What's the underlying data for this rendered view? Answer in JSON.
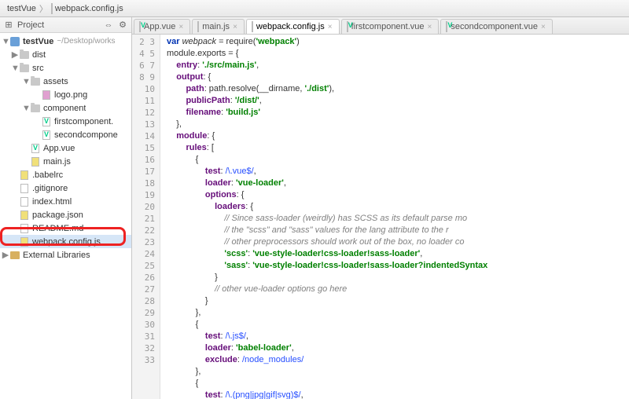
{
  "breadcrumb": {
    "root": "testVue",
    "file": "webpack.config.js"
  },
  "sidebar": {
    "title": "Project",
    "root_name": "testVue",
    "root_path": "~/Desktop/works",
    "nodes": {
      "dist": "dist",
      "src": "src",
      "assets": "assets",
      "logo": "logo.png",
      "component": "component",
      "firstcomp": "firstcomponent.",
      "secondcomp": "secondcompone",
      "appvue": "App.vue",
      "mainjs": "main.js",
      "babelrc": ".babelrc",
      "gitignore": ".gitignore",
      "indexhtml": "index.html",
      "packagejson": "package.json",
      "readme": "README.md",
      "webpack": "webpack.config.js",
      "extlib": "External Libraries"
    }
  },
  "tabs": [
    {
      "label": "App.vue",
      "active": false,
      "kind": "vue"
    },
    {
      "label": "main.js",
      "active": false,
      "kind": "js"
    },
    {
      "label": "webpack.config.js",
      "active": true,
      "kind": "js"
    },
    {
      "label": "firstcomponent.vue",
      "active": false,
      "kind": "vue"
    },
    {
      "label": "secondcomponent.vue",
      "active": false,
      "kind": "vue"
    }
  ],
  "gutter": {
    "start": 2,
    "end": 33
  },
  "code_lines": [
    [
      [
        "kw",
        "var"
      ],
      [
        "",
        " "
      ],
      [
        "id",
        "webpack"
      ],
      [
        "",
        " = require("
      ],
      [
        "str",
        "'webpack'"
      ],
      [
        "",
        ")"
      ]
    ],
    [
      [
        "",
        ""
      ]
    ],
    [
      [
        "",
        "module.exports = {"
      ]
    ],
    [
      [
        "",
        "    "
      ],
      [
        "fld",
        "entry"
      ],
      [
        "",
        ": "
      ],
      [
        "str",
        "'./src/main.js'"
      ],
      [
        "",
        ","
      ]
    ],
    [
      [
        "",
        "    "
      ],
      [
        "fld",
        "output"
      ],
      [
        "",
        ": {"
      ]
    ],
    [
      [
        "",
        "        "
      ],
      [
        "fld",
        "path"
      ],
      [
        "",
        ": path.resolve(__dirname, "
      ],
      [
        "str",
        "'./dist'"
      ],
      [
        "",
        "),"
      ]
    ],
    [
      [
        "",
        "        "
      ],
      [
        "fld",
        "publicPath"
      ],
      [
        "",
        ": "
      ],
      [
        "str",
        "'/dist/'"
      ],
      [
        "",
        ","
      ]
    ],
    [
      [
        "",
        "        "
      ],
      [
        "fld",
        "filename"
      ],
      [
        "",
        ": "
      ],
      [
        "str",
        "'build.js'"
      ]
    ],
    [
      [
        "",
        "    },"
      ]
    ],
    [
      [
        "",
        "    "
      ],
      [
        "fld",
        "module"
      ],
      [
        "",
        ": {"
      ]
    ],
    [
      [
        "",
        "        "
      ],
      [
        "fld",
        "rules"
      ],
      [
        "",
        ": ["
      ]
    ],
    [
      [
        "",
        "            {"
      ]
    ],
    [
      [
        "",
        "                "
      ],
      [
        "fld",
        "test"
      ],
      [
        "",
        ": "
      ],
      [
        "rgx",
        "/\\.vue$/"
      ],
      [
        "",
        ","
      ]
    ],
    [
      [
        "",
        "                "
      ],
      [
        "fld",
        "loader"
      ],
      [
        "",
        ": "
      ],
      [
        "str",
        "'vue-loader'"
      ],
      [
        "",
        ","
      ]
    ],
    [
      [
        "",
        "                "
      ],
      [
        "fld",
        "options"
      ],
      [
        "",
        ": {"
      ]
    ],
    [
      [
        "",
        "                    "
      ],
      [
        "fld",
        "loaders"
      ],
      [
        "",
        ": {"
      ]
    ],
    [
      [
        "",
        "                        "
      ],
      [
        "cmt",
        "// Since sass-loader (weirdly) has SCSS as its default parse mo"
      ]
    ],
    [
      [
        "",
        "                        "
      ],
      [
        "cmt",
        "// the \"scss\" and \"sass\" values for the lang attribute to the r"
      ]
    ],
    [
      [
        "",
        "                        "
      ],
      [
        "cmt",
        "// other preprocessors should work out of the box, no loader co"
      ]
    ],
    [
      [
        "",
        "                        "
      ],
      [
        "str",
        "'scss'"
      ],
      [
        "",
        ": "
      ],
      [
        "str",
        "'vue-style-loader!css-loader!sass-loader'"
      ],
      [
        "",
        ","
      ]
    ],
    [
      [
        "",
        "                        "
      ],
      [
        "str",
        "'sass'"
      ],
      [
        "",
        ": "
      ],
      [
        "str",
        "'vue-style-loader!css-loader!sass-loader?indentedSyntax"
      ]
    ],
    [
      [
        "",
        "                    }"
      ]
    ],
    [
      [
        "",
        "                    "
      ],
      [
        "cmt",
        "// other vue-loader options go here"
      ]
    ],
    [
      [
        "",
        "                }"
      ]
    ],
    [
      [
        "",
        "            },"
      ]
    ],
    [
      [
        "",
        "            {"
      ]
    ],
    [
      [
        "",
        "                "
      ],
      [
        "fld",
        "test"
      ],
      [
        "",
        ": "
      ],
      [
        "rgx",
        "/\\.js$/"
      ],
      [
        "",
        ","
      ]
    ],
    [
      [
        "",
        "                "
      ],
      [
        "fld",
        "loader"
      ],
      [
        "",
        ": "
      ],
      [
        "str",
        "'babel-loader'"
      ],
      [
        "",
        ","
      ]
    ],
    [
      [
        "",
        "                "
      ],
      [
        "fld",
        "exclude"
      ],
      [
        "",
        ": "
      ],
      [
        "rgx",
        "/node_modules/"
      ]
    ],
    [
      [
        "",
        "            },"
      ]
    ],
    [
      [
        "",
        "            {"
      ]
    ],
    [
      [
        "",
        "                "
      ],
      [
        "fld",
        "test"
      ],
      [
        "",
        ": "
      ],
      [
        "rgx",
        "/\\.(png|jpg|gif|svg)$/"
      ],
      [
        "",
        ","
      ]
    ]
  ]
}
